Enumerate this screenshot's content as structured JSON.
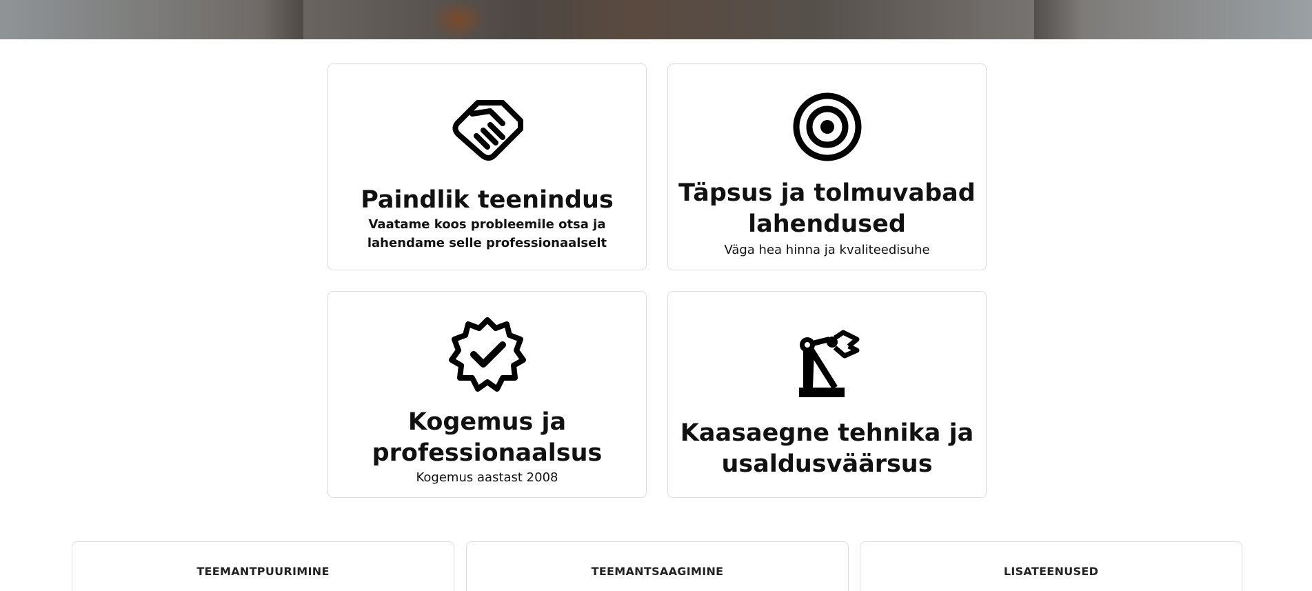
{
  "features": [
    {
      "icon": "handshake-icon",
      "title": "Paindlik teenindus",
      "description": "Vaatame koos probleemile otsa ja lahendame selle professionaalselt"
    },
    {
      "icon": "target-icon",
      "title": "Täpsus ja tolmuvabad lahendused",
      "description": "Väga hea hinna ja kvaliteedisuhe"
    },
    {
      "icon": "verified-badge-icon",
      "title": "Kogemus ja professionaalsus",
      "description": "Kogemus aastast 2008"
    },
    {
      "icon": "robotic-arm-icon",
      "title": "Kaasaegne tehnika ja usaldusväärsus",
      "description": ""
    }
  ],
  "services": [
    {
      "label": "TEEMANTPUURIMINE"
    },
    {
      "label": "TEEMANTSAAGIMINE"
    },
    {
      "label": "LISATEENUSED"
    }
  ],
  "colors": {
    "text": "#111111",
    "border": "#dcdcdc",
    "background": "#ffffff"
  }
}
